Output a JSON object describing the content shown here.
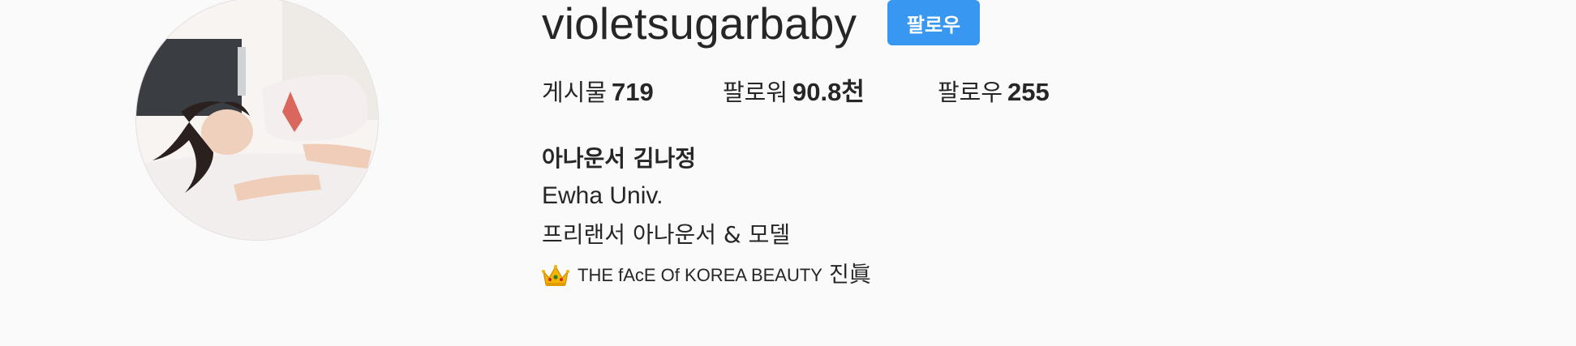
{
  "profile": {
    "username": "violetsugarbaby",
    "follow_label": "팔로우",
    "stats": [
      {
        "label": "게시물",
        "count": "719"
      },
      {
        "label": "팔로워",
        "count": "90.8천"
      },
      {
        "label": "팔로우",
        "count": "255"
      }
    ],
    "bio": {
      "name": "아나운서 김나정",
      "lines": [
        "Ewha Univ.",
        "프리랜서 아나운서 & 모델"
      ],
      "tagline_text": "THE fAcE Of KOREA BEAUTY",
      "tagline_hanja": "진眞"
    }
  },
  "icons": {
    "avatar": "profile-photo",
    "crown": "crown-emoji"
  },
  "colors": {
    "background": "#fafafa",
    "follow_button": "#3897f0",
    "text": "#262626"
  }
}
